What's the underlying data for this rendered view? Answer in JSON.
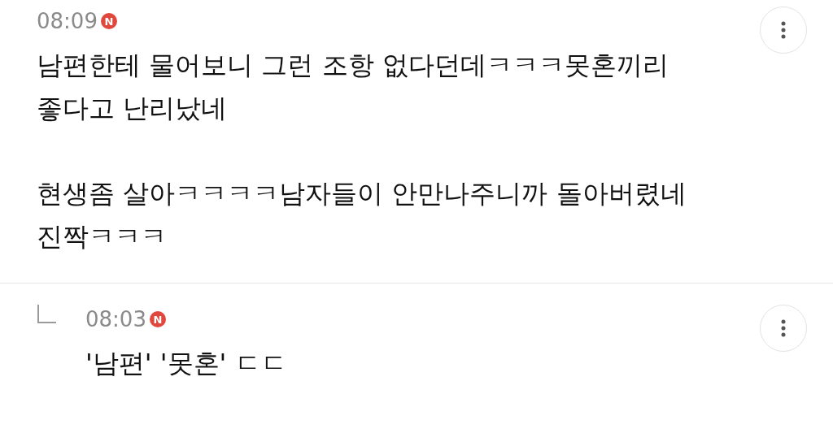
{
  "comments": [
    {
      "kind": "comment",
      "time": "08:09",
      "badge": "N",
      "paragraphs": [
        [
          "남편한테 물어보니 그런 조항 없다던데ㅋㅋㅋ못혼끼리",
          "좋다고 난리났네"
        ],
        [
          "현생좀 살아ㅋㅋㅋㅋ남자들이 안만나주니까 돌아버렸네",
          "진짝ㅋㅋㅋ"
        ]
      ]
    },
    {
      "kind": "reply",
      "time": "08:03",
      "badge": "N",
      "paragraphs": [
        [
          "'남편' '못혼' ㄷㄷ"
        ]
      ]
    }
  ]
}
